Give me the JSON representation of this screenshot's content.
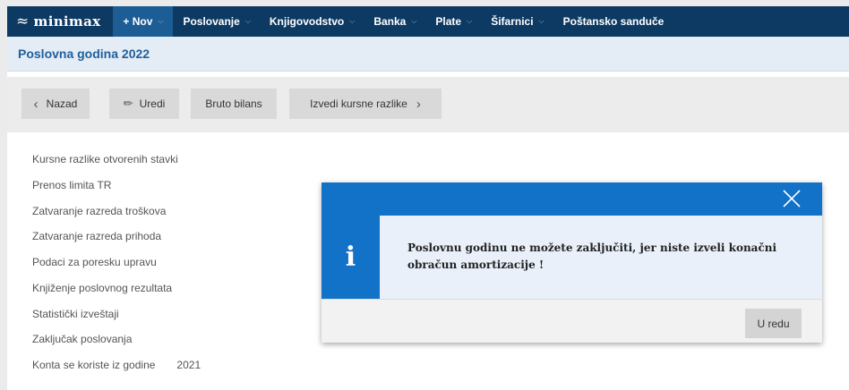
{
  "nav": {
    "logo": "minimax",
    "new_label": "+ Nov",
    "items": [
      {
        "label": "Poslovanje"
      },
      {
        "label": "Knjigovodstvo"
      },
      {
        "label": "Banka"
      },
      {
        "label": "Plate"
      },
      {
        "label": "Šifarnici"
      },
      {
        "label": "Poštansko sanduče"
      }
    ]
  },
  "page": {
    "title": "Poslovna godina 2022"
  },
  "toolbar": {
    "back_label": "Nazad",
    "edit_label": "Uredi",
    "bruto_label": "Bruto bilans",
    "izvedi_label": "Izvedi kursne razlike"
  },
  "list": {
    "items": [
      {
        "label": "Kursne razlike otvorenih stavki"
      },
      {
        "label": "Prenos limita TR"
      },
      {
        "label": "Zatvaranje razreda troškova"
      },
      {
        "label": "Zatvaranje razreda prihoda"
      },
      {
        "label": "Podaci za poresku upravu"
      },
      {
        "label": "Knjiženje poslovnog rezultata"
      },
      {
        "label": "Statistički izveštaji"
      },
      {
        "label": "Zaključak poslovanja"
      },
      {
        "label": "Konta se koriste iz godine",
        "value": "2021"
      }
    ]
  },
  "modal": {
    "icon_letter": "i",
    "message": "Poslovnu godinu ne možete zaključiti, jer niste izveli konačni obračun amortizacije !",
    "ok_label": "U redu"
  },
  "colors": {
    "topbar": "#0d3a63",
    "new_button": "#1d5d96",
    "title_text": "#1f5f9b",
    "modal_accent": "#1172c8",
    "modal_body": "#e9f0fa"
  },
  "icons": [
    "minimax-logo-icon",
    "chevron-down-icon",
    "chevron-left-icon",
    "pencil-icon",
    "chevron-right-icon",
    "close-icon",
    "info-icon"
  ]
}
